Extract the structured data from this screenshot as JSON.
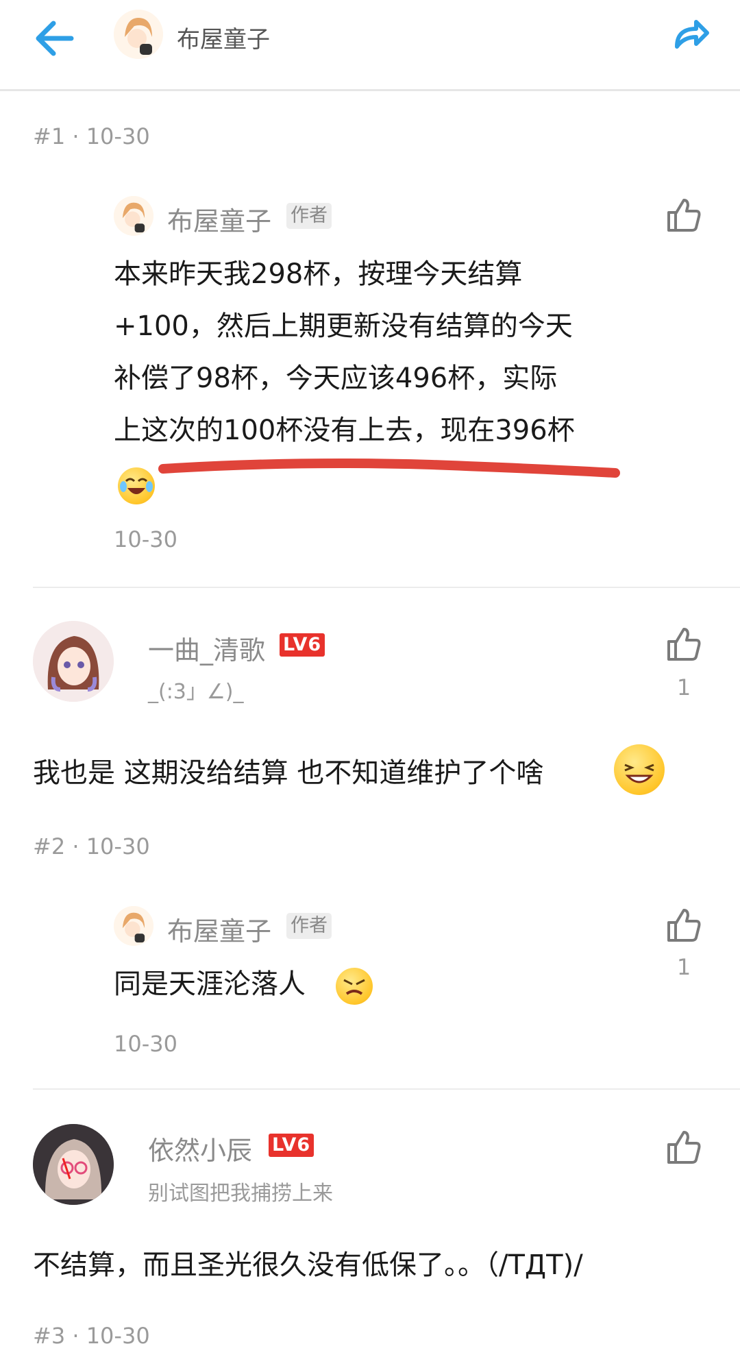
{
  "header": {
    "title": "布屋童子"
  },
  "comments": [
    {
      "floor": "#1 · 10-30",
      "replies": [
        {
          "user": "布屋童子",
          "badge": "作者",
          "text_lines": [
            "本来昨天我298杯，按理今天结算",
            "+100，然后上期更新没有结算的今天",
            "补偿了98杯，今天应该496杯，实际",
            "上这次的100杯没有上去，现在396杯"
          ],
          "time": "10-30"
        }
      ]
    },
    {
      "user": "一曲_清歌",
      "level": "LV6",
      "signature": "_(:3」∠)_",
      "likes": "1",
      "text": "我也是 这期没给结算 也不知道维护了个啥",
      "floor": "#2 · 10-30",
      "replies": [
        {
          "user": "布屋童子",
          "badge": "作者",
          "text": "同是天涯沦落人",
          "likes": "1",
          "time": "10-30"
        }
      ]
    },
    {
      "user": "依然小辰",
      "level": "LV6",
      "signature": "别试图把我捕捞上来",
      "text": "不结算，而且圣光很久没有低保了。。（/TДT)/",
      "floor": "#3 · 10-30"
    }
  ],
  "icons": {
    "back": "back-arrow-icon",
    "share": "share-icon",
    "like": "thumbs-up-icon"
  },
  "colors": {
    "accent": "#2e9fe6",
    "level_badge": "#e8322c",
    "underline": "#e0443a"
  }
}
